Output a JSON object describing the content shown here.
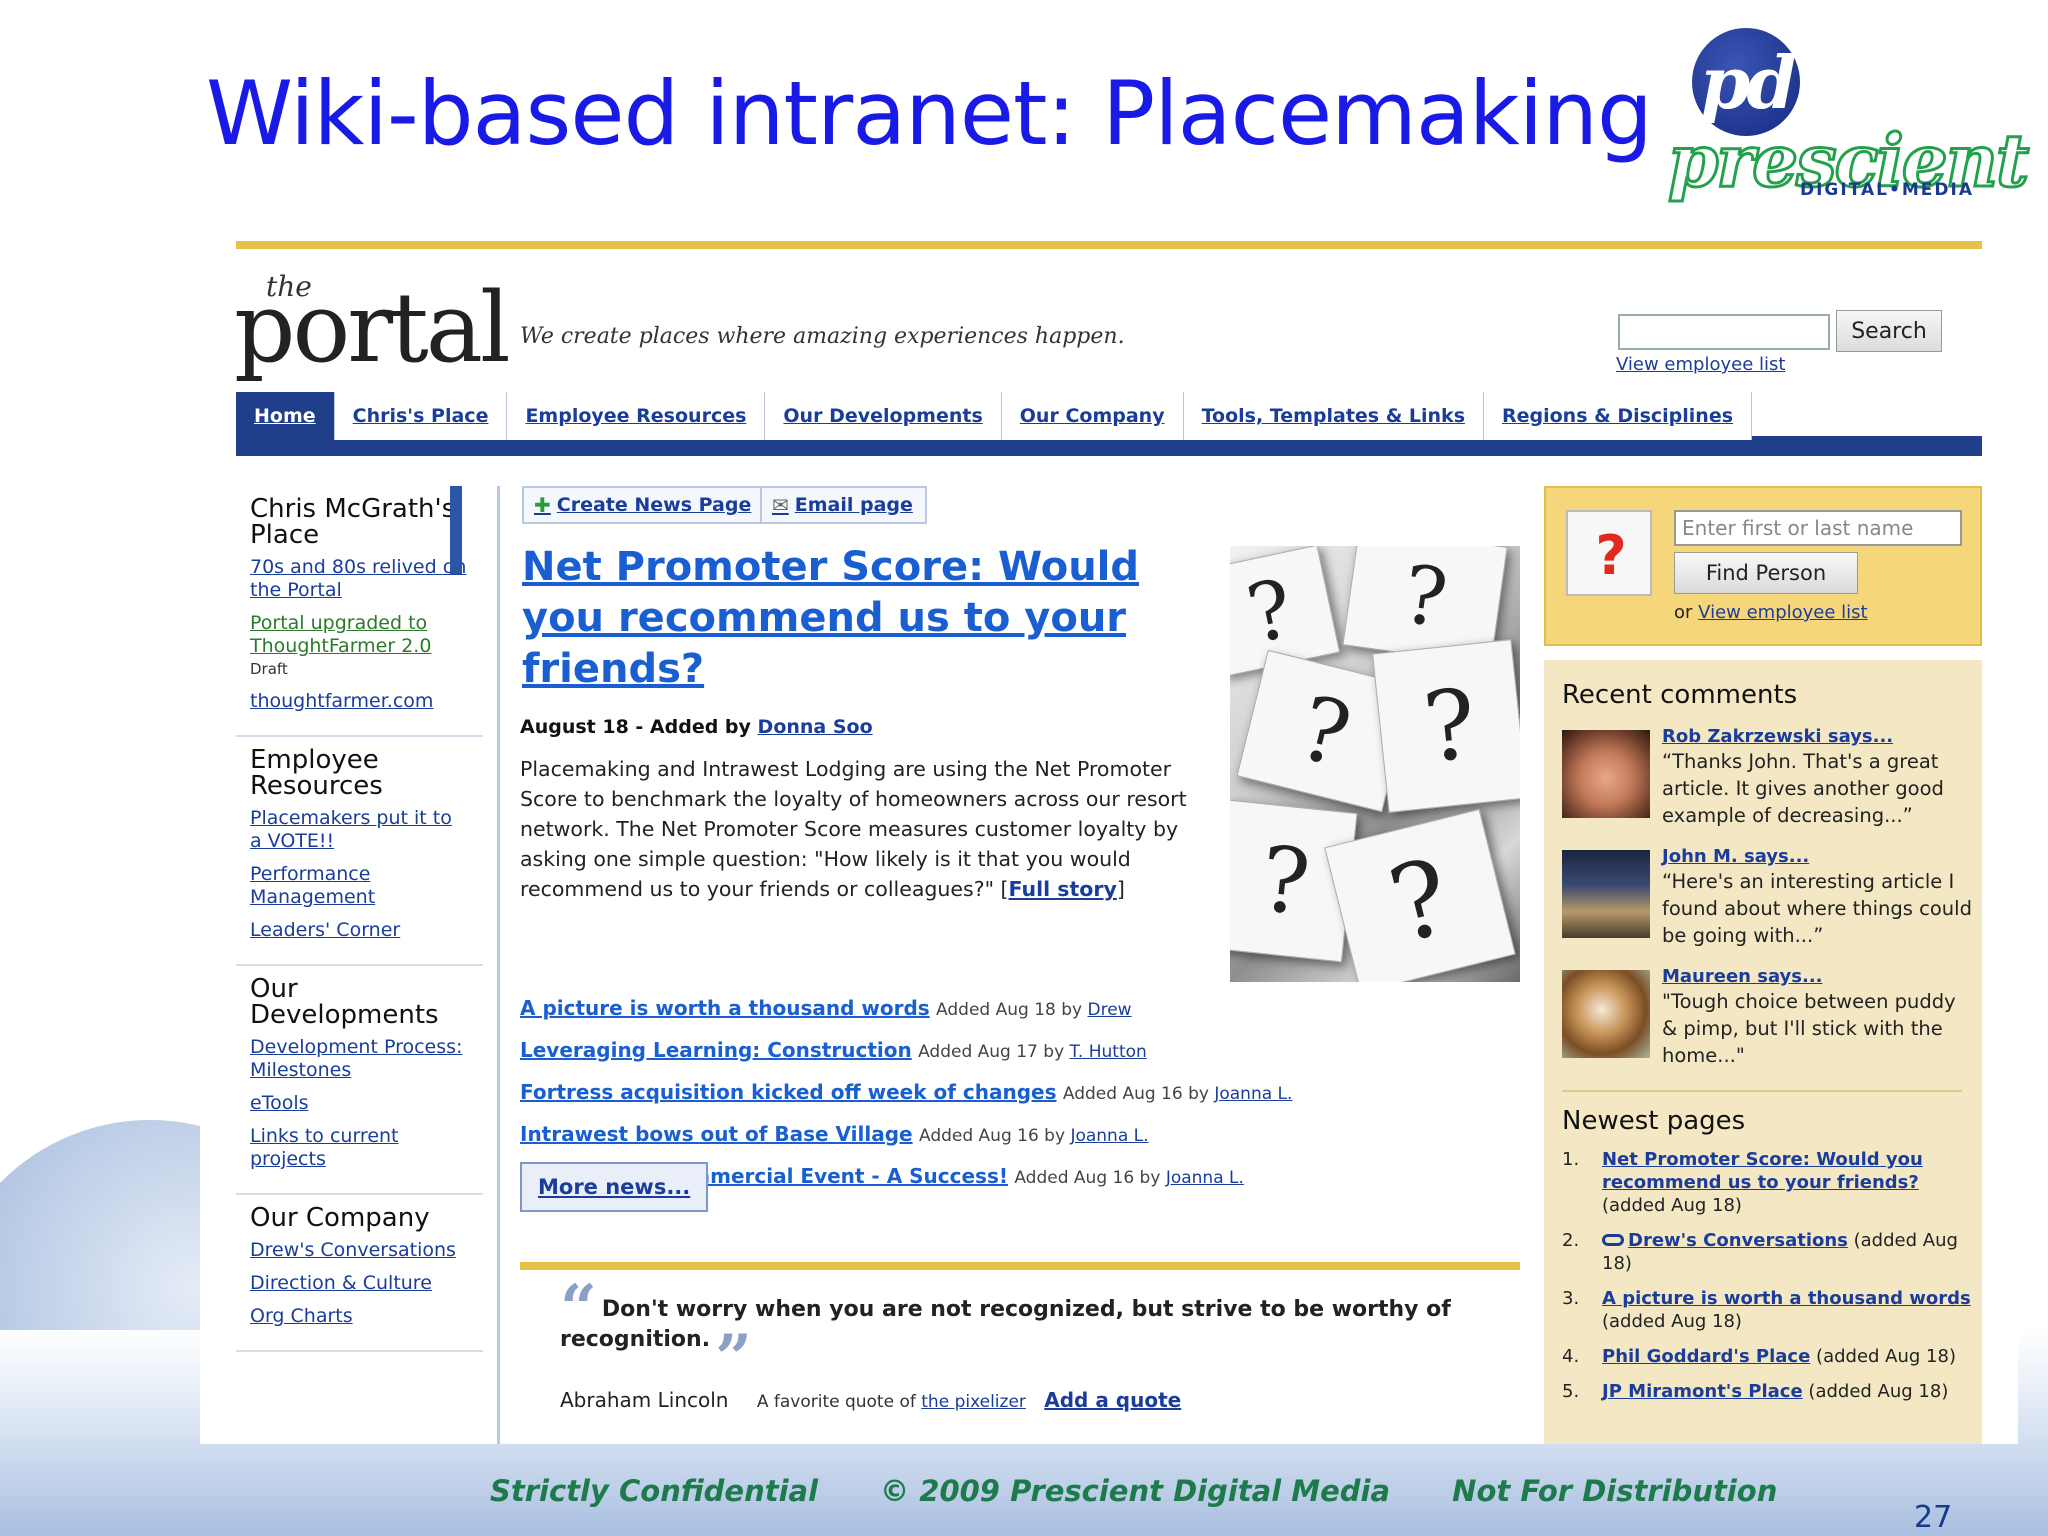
{
  "slide": {
    "title": "Wiki-based intranet: Placemaking",
    "page_number": "27",
    "footer": [
      "Strictly Confidential",
      "© 2009 Prescient Digital Media",
      "Not For Distribution"
    ]
  },
  "logo": {
    "monogram": "pd",
    "wordmark": "prescient",
    "subtitle": "DIGITAL•MEDIA"
  },
  "portal": {
    "brand_the": "the",
    "brand_word": "portal",
    "tagline": "We create places where amazing experiences happen.",
    "search_button": "Search",
    "view_employee_list": "View employee list"
  },
  "nav": {
    "tabs": [
      {
        "label": "Home",
        "active": true
      },
      {
        "label": "Chris's Place"
      },
      {
        "label": "Employee Resources"
      },
      {
        "label": "Our Developments"
      },
      {
        "label": "Our Company"
      },
      {
        "label": "Tools, Templates & Links"
      },
      {
        "label": "Regions & Disciplines"
      }
    ]
  },
  "sidebar": {
    "sections": [
      {
        "heading": "Chris McGrath's Place",
        "links": [
          "70s and 80s relived on the Portal",
          "Portal upgraded to ThoughtFarmer 2.0",
          "thoughtfarmer.com"
        ],
        "draft": "Draft"
      },
      {
        "heading": "Employee Resources",
        "links": [
          "Placemakers put it to a VOTE!!",
          "Performance Management",
          "Leaders' Corner"
        ]
      },
      {
        "heading": "Our Developments",
        "links": [
          "Development Process: Milestones",
          "eTools",
          "Links to current projects"
        ]
      },
      {
        "heading": "Our Company",
        "links": [
          "Drew's Conversations",
          "Direction & Culture",
          "Org Charts"
        ]
      }
    ]
  },
  "main": {
    "create_news_page": "Create News Page",
    "email_page": "Email page",
    "headline": "Net Promoter Score: Would you recommend us to your friends?",
    "byline_date": "August 18 - Added by",
    "byline_author": "Donna Soo",
    "lede": "Placemaking and Intrawest Lodging are using the Net Promoter Score to benchmark the loyalty of homeowners across our resort network. The Net Promoter Score measures customer loyalty by asking one simple question: \"How likely is it that you would recommend us to your friends or colleagues?\"",
    "full_story": "Full story",
    "news": [
      {
        "title": "A picture is worth a thousand words",
        "meta": "Added Aug 18 by",
        "author": "Drew"
      },
      {
        "title": "Leveraging Learning: Construction",
        "meta": "Added Aug 17 by",
        "author": "T. Hutton"
      },
      {
        "title": "Fortress acquisition kicked off week of changes",
        "meta": "Added Aug 16 by",
        "author": "Joanna L."
      },
      {
        "title": "Intrawest bows out of Base Village",
        "meta": "Added Aug 16 by",
        "author": "Joanna L."
      },
      {
        "title": "Winter Park Commercial Event - A Success!",
        "meta": "Added Aug 16 by",
        "author": "Joanna L."
      }
    ],
    "more_news": "More news...",
    "quote": {
      "text": "Don't worry when you are not recognized, but strive to be worthy of recognition.",
      "author": "Abraham Lincoln",
      "favorite_of": "A favorite quote of",
      "favorite_user": "the pixelizer",
      "add_quote": "Add a quote"
    }
  },
  "finder": {
    "placeholder": "Enter first or last name",
    "button": "Find Person",
    "or": "or",
    "view_employee_list": "View employee list"
  },
  "recent_comments": {
    "title": "Recent comments",
    "items": [
      {
        "author": "Rob Zakrzewski says...",
        "text": "“Thanks John. That's a great article. It gives another good example of decreasing...”"
      },
      {
        "author": "John M. says...",
        "text": "“Here's an interesting article I found about where things could be going with...”"
      },
      {
        "author": "Maureen says...",
        "text": "\"Tough choice between puddy & pimp, but I'll stick with the home...\""
      }
    ]
  },
  "newest_pages": {
    "title": "Newest pages",
    "items": [
      {
        "num": "1.",
        "link": "Net Promoter Score: Would you recommend us to your friends?",
        "meta": "(added Aug 18)"
      },
      {
        "num": "2.",
        "link": "Drew's Conversations",
        "meta": "(added Aug 18)"
      },
      {
        "num": "3.",
        "link": "A picture is worth a thousand words",
        "meta": "(added Aug 18)"
      },
      {
        "num": "4.",
        "link": "Phil Goddard's Place",
        "meta": "(added Aug 18)"
      },
      {
        "num": "5.",
        "link": "JP Miramont's Place",
        "meta": "(added Aug 18)"
      }
    ]
  }
}
